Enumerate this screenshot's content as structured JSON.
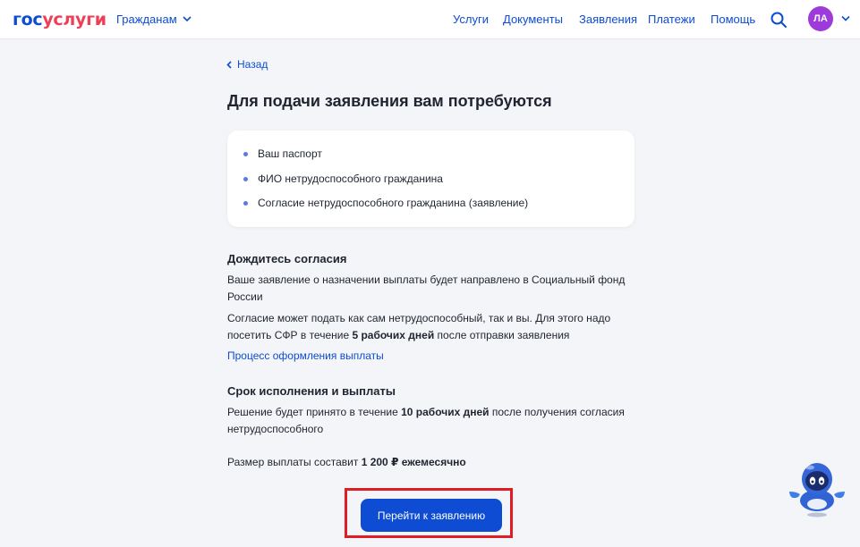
{
  "header": {
    "logo_part1": "гос",
    "logo_part2": "услуги",
    "citizens_label": "Гражданам",
    "nav": [
      "Услуги",
      "Документы",
      "Заявления",
      "Платежи",
      "Помощь"
    ],
    "avatar_initials": "ЛА"
  },
  "main": {
    "back_label": "Назад",
    "title": "Для подачи заявления вам потребуются",
    "requirements": [
      "Ваш паспорт",
      "ФИО нетрудоспособного гражданина",
      "Согласие нетрудоспособного гражданина (заявление)"
    ],
    "consent": {
      "title": "Дождитесь согласия",
      "p1_line1": "Ваше заявление о назначении выплаты будет направлено в Социальный фонд",
      "p1_line2": "России",
      "p2_line1": "Согласие может подать как сам нетрудоспособный, так и вы. Для этого надо",
      "p2_line2_pre": "посетить СФР в течение ",
      "p2_line2_bold": "5 рабочих дней",
      "p2_line2_post": " после отправки заявления",
      "link": "Процесс оформления выплаты"
    },
    "deadline": {
      "title": "Срок исполнения и выплаты",
      "p1_line1_pre": "Решение будет принято в течение ",
      "p1_line1_bold": "10 рабочих дней",
      "p1_line1_post": " после получения согласия",
      "p1_line2": "нетрудоспособного",
      "p2_pre": "Размер выплаты составит ",
      "p2_bold": "1 200 ₽ ежемесячно"
    },
    "cta_label": "Перейти к заявлению"
  },
  "colors": {
    "brand_blue": "#0d4cd3",
    "brand_red": "#ee3f58",
    "highlight_red": "#e01c24",
    "avatar": "#9d3ad9",
    "background": "#f4f5f8"
  },
  "icons": [
    "chevron-down-icon",
    "search-icon",
    "chevron-left-icon",
    "assistant-robot-icon"
  ]
}
